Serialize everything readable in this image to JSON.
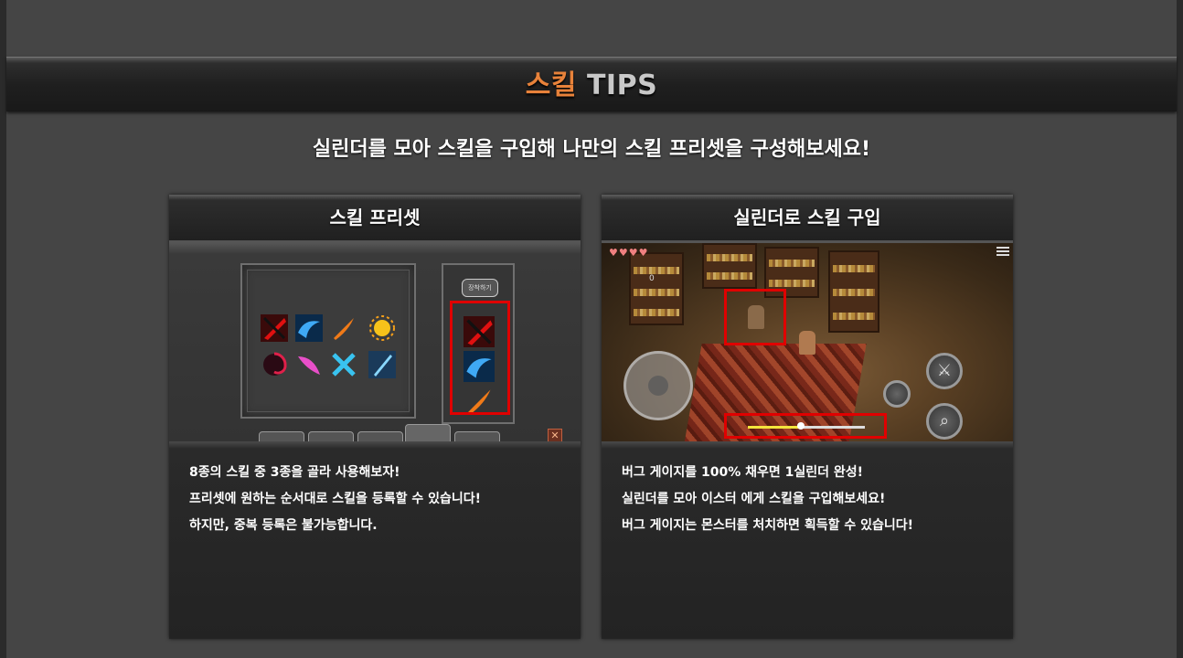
{
  "banner": {
    "title_accent": "스킬",
    "title_rest": "TIPS"
  },
  "subtitle": "실린더를 모아 스킬을 구입해 나만의 스킬 프리셋을 구성해보세요!",
  "cards": [
    {
      "header": "스킬 프리셋",
      "image": {
        "equip_button_label": "장착하기",
        "skill_icons": [
          "red-slash-icon",
          "blue-wave-icon",
          "fire-feather-icon",
          "sun-burst-icon",
          "dark-vortex-icon",
          "pink-feather-icon",
          "cross-blades-icon",
          "blue-blade-icon"
        ],
        "equipped_icons": [
          "red-slash-icon",
          "blue-wave-icon",
          "fire-feather-icon"
        ]
      },
      "lines": [
        "8종의 스킬 중 3종을 골라 사용해보자!",
        "프리셋에 원하는 순서대로 스킬을 등록할 수 있습니다!",
        "하지만, 중복 등록은 불가능합니다."
      ]
    },
    {
      "header": "실린더로 스킬 구입",
      "image": {
        "hearts": "♥♥♥♥",
        "counter": "0",
        "bug_gauge_level": 0.45
      },
      "lines": [
        "버그 게이지를 100% 채우면 1실린더 완성!",
        "실린더를 모아 이스터 에게 스킬을 구입해보세요!",
        "버그 게이지는 몬스터를 처치하면 획득할 수 있습니다!"
      ]
    }
  ],
  "colors": {
    "accent": "#e8823a",
    "highlight_box": "#e00000",
    "gauge": "#f4e43c"
  }
}
